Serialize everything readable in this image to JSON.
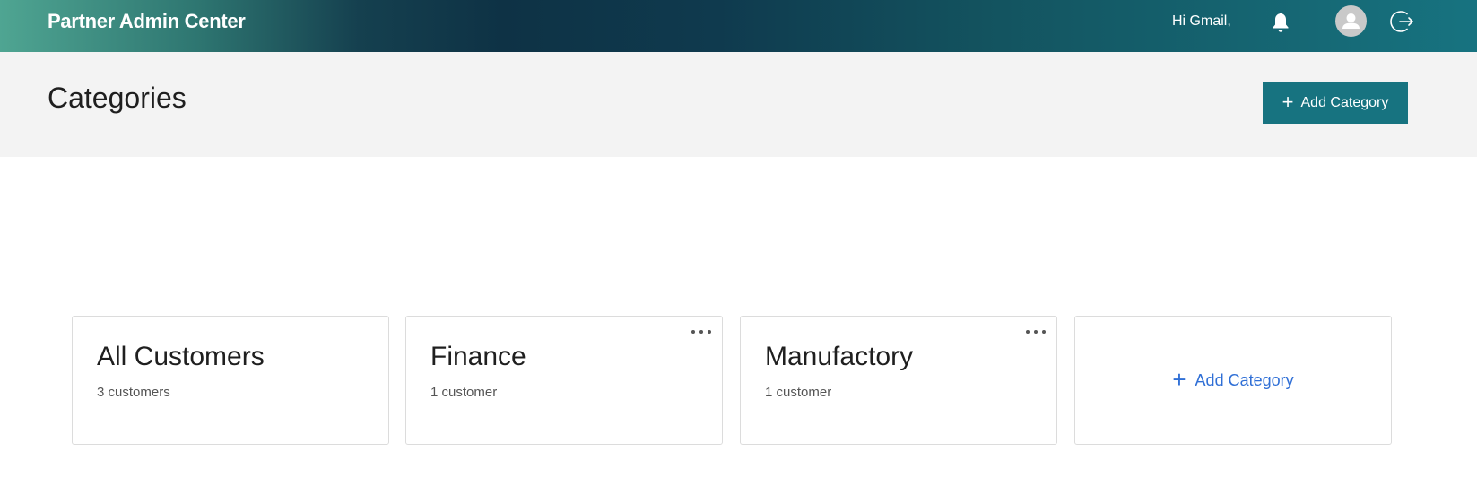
{
  "header": {
    "brand": "Partner Admin Center",
    "greeting": "Hi Gmail,",
    "icons": {
      "notifications": "bell-icon",
      "user": "avatar-icon",
      "logout": "logout-icon"
    }
  },
  "page": {
    "title": "Categories",
    "add_button_label": "Add Category"
  },
  "cards": [
    {
      "title": "All Customers",
      "subtitle": "3 customers",
      "has_menu": false
    },
    {
      "title": "Finance",
      "subtitle": "1 customer",
      "has_menu": true
    },
    {
      "title": "Manufactory",
      "subtitle": "1 customer",
      "has_menu": true
    }
  ],
  "add_card": {
    "label": "Add Category"
  },
  "colors": {
    "accent": "#177380",
    "link": "#2f6fd6",
    "header_bg": "#f3f3f3"
  }
}
